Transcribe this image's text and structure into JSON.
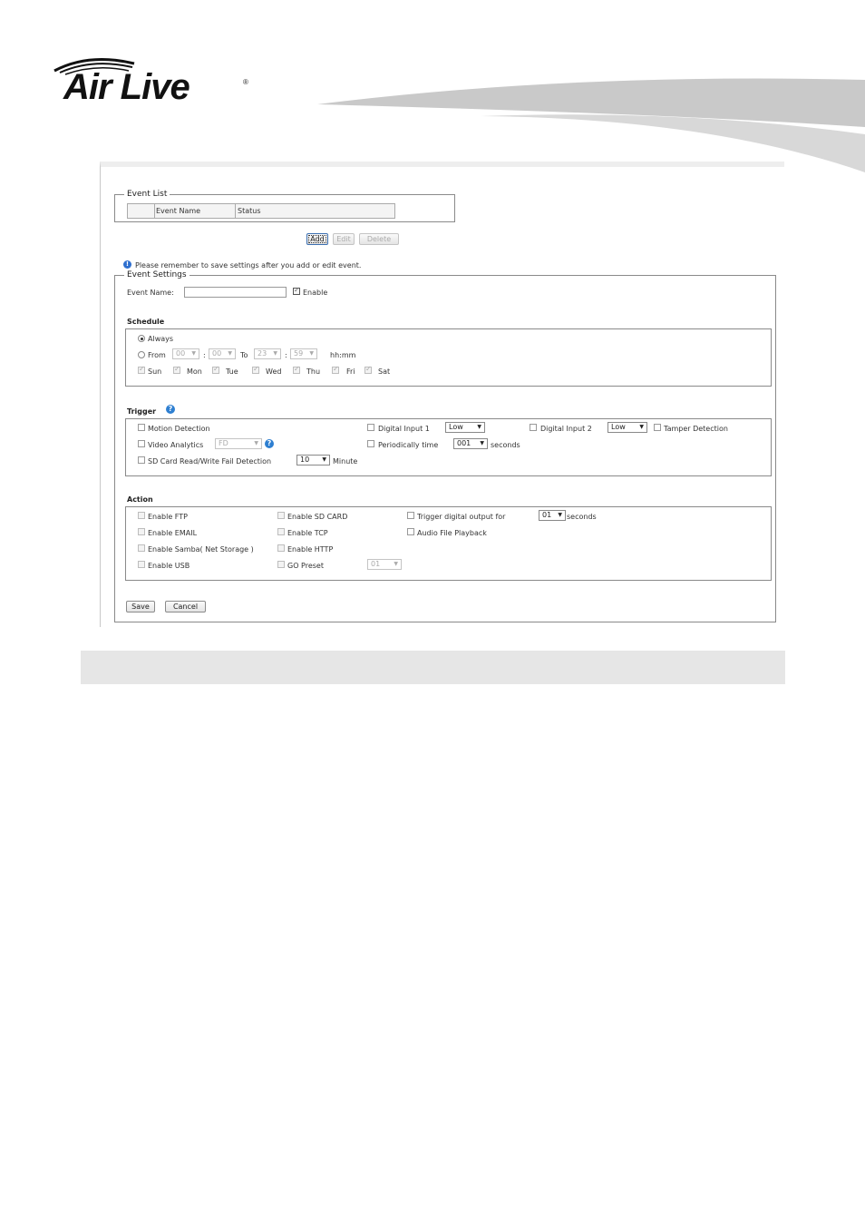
{
  "brand": {
    "logo_text": "Air Live",
    "registered": "®"
  },
  "event_list": {
    "legend": "Event List",
    "columns": [
      "",
      "Event Name",
      "Status"
    ],
    "buttons": {
      "add": "Add",
      "edit": "Edit",
      "delete": "Delete"
    }
  },
  "notice": "Please remember to save settings after you add or edit event.",
  "event_settings": {
    "legend": "Event Settings",
    "event_name_label": "Event Name:",
    "event_name_value": "",
    "enable_label": "Enable",
    "enable_checked": true
  },
  "schedule": {
    "title": "Schedule",
    "always_label": "Always",
    "from_label": "From",
    "to_label": "To",
    "from_hour": "00",
    "from_min": "00",
    "to_hour": "23",
    "to_min": "59",
    "colon": ":",
    "format_label": "hh:mm",
    "days": [
      "Sun",
      "Mon",
      "Tue",
      "Wed",
      "Thu",
      "Fri",
      "Sat"
    ]
  },
  "trigger": {
    "title": "Trigger",
    "motion_detection": "Motion Detection",
    "digital_input_1": "Digital Input 1",
    "digital_input_1_value": "Low",
    "digital_input_2": "Digital Input 2",
    "digital_input_2_value": "Low",
    "tamper_detection": "Tamper Detection",
    "video_analytics": "Video Analytics",
    "video_analytics_value": "FD",
    "periodically_time": "Periodically time",
    "periodically_value": "001",
    "seconds_label": "seconds",
    "sd_fail": "SD Card Read/Write Fail Detection",
    "sd_fail_value": "10",
    "minute_label": "Minute"
  },
  "action": {
    "title": "Action",
    "enable_ftp": "Enable FTP",
    "enable_sd_card": "Enable SD CARD",
    "trigger_digital_output": "Trigger digital output for",
    "trigger_output_value": "01",
    "seconds_label": "seconds",
    "enable_email": "Enable EMAIL",
    "enable_tcp": "Enable TCP",
    "audio_playback": "Audio File Playback",
    "enable_samba": "Enable Samba( Net Storage )",
    "enable_http": "Enable HTTP",
    "enable_usb": "Enable USB",
    "go_preset": "GO Preset",
    "go_preset_value": "01"
  },
  "footer_buttons": {
    "save": "Save",
    "cancel": "Cancel"
  }
}
